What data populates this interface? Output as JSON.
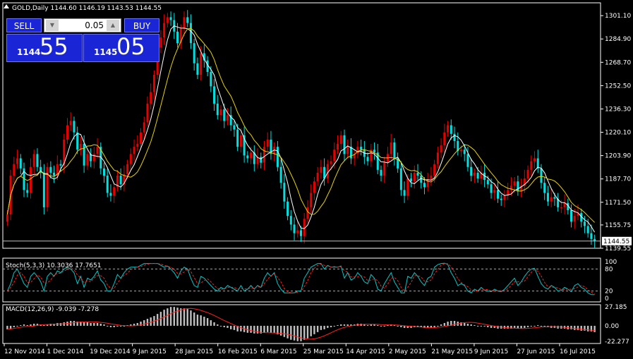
{
  "colors": {
    "background": "#000000",
    "frame": "#ffffff",
    "bull": "#e60000",
    "bear": "#00e1e1",
    "ma_fast": "#ffffff",
    "ma_slow": "#e6d200",
    "stoch_main": "#00c8c8",
    "stoch_signal": "#ff2020",
    "macd_hist": "#c0c0c0",
    "macd_signal": "#ff2020",
    "price_line": "#c0c0c0",
    "button_blue": "#1a25d6"
  },
  "header": {
    "title": "GOLD,Daily  1144.60 1146.19 1143.53 1144.55"
  },
  "trade": {
    "sell_label": "SELL",
    "buy_label": "BUY",
    "lot_value": "0.05",
    "bid_small": "1144",
    "bid_big": "55",
    "ask_small": "1145",
    "ask_big": "05",
    "down_arrow": "▼",
    "up_arrow": "▲"
  },
  "price_axis": {
    "ticks": [
      "1301.10",
      "1284.90",
      "1268.70",
      "1252.50",
      "1236.30",
      "1220.10",
      "1203.90",
      "1187.70",
      "1171.50",
      "1155.75",
      "1139.55"
    ],
    "current": "1144.55"
  },
  "stoch": {
    "label": "Stoch(5,3,3) 10.3036 17.7651",
    "ticks": [
      "100",
      "80",
      "20",
      "0"
    ]
  },
  "macd": {
    "label": "MACD(12,26,9) -9.039 -7.278",
    "ticks": [
      "27.185",
      "0.00",
      "-22.277"
    ]
  },
  "time_axis": {
    "labels": [
      "12 Nov 2014",
      "1 Dec 2014",
      "19 Dec 2014",
      "9 Jan 2015",
      "28 Jan 2015",
      "16 Feb 2015",
      "6 Mar 2015",
      "25 Mar 2015",
      "14 Apr 2015",
      "2 May 2015",
      "21 May 2015",
      "9 Jun 2015",
      "27 Jun 2015",
      "16 Jul 2015"
    ]
  },
  "chart_data": {
    "type": "candlestick",
    "title": "GOLD,Daily  1144.60 1146.19 1143.53 1144.55",
    "y_range": [
      1139.55,
      1310
    ],
    "series": [
      {
        "name": "close",
        "values": [
          1163,
          1190,
          1198,
          1202,
          1195,
          1180,
          1178,
          1196,
          1205,
          1196,
          1192,
          1168,
          1196,
          1192,
          1190,
          1198,
          1197,
          1215,
          1225,
          1228,
          1220,
          1208,
          1212,
          1197,
          1205,
          1200,
          1205,
          1210,
          1195,
          1190,
          1178,
          1176,
          1182,
          1190,
          1184,
          1191,
          1198,
          1205,
          1210,
          1212,
          1220,
          1227,
          1240,
          1248,
          1260,
          1279,
          1286,
          1296,
          1300,
          1298,
          1290,
          1282,
          1292,
          1300,
          1296,
          1282,
          1268,
          1260,
          1275,
          1270,
          1262,
          1252,
          1240,
          1232,
          1236,
          1228,
          1232,
          1225,
          1222,
          1210,
          1218,
          1204,
          1202,
          1206,
          1198,
          1203,
          1199,
          1210,
          1215,
          1205,
          1210,
          1196,
          1185,
          1172,
          1162,
          1156,
          1150,
          1152,
          1148,
          1160,
          1168,
          1178,
          1186,
          1192,
          1196,
          1188,
          1198,
          1200,
          1208,
          1212,
          1218,
          1205,
          1210,
          1202,
          1205,
          1210,
          1208,
          1203,
          1200,
          1208,
          1206,
          1194,
          1190,
          1199,
          1205,
          1213,
          1202,
          1195,
          1180,
          1176,
          1188,
          1186,
          1192,
          1190,
          1185,
          1182,
          1187,
          1190,
          1198,
          1206,
          1211,
          1220,
          1225,
          1219,
          1214,
          1207,
          1208,
          1205,
          1196,
          1190,
          1192,
          1188,
          1192,
          1187,
          1184,
          1178,
          1180,
          1174,
          1173,
          1176,
          1180,
          1183,
          1186,
          1179,
          1183,
          1188,
          1194,
          1200,
          1202,
          1195,
          1185,
          1178,
          1172,
          1175,
          1174,
          1168,
          1168,
          1171,
          1166,
          1158,
          1162,
          1164,
          1158,
          1155,
          1150,
          1146,
          1144.55
        ]
      },
      {
        "name": "stoch_main",
        "values": [
          20,
          40,
          70,
          80,
          60,
          40,
          30,
          60,
          70,
          60,
          45,
          20,
          60,
          70,
          60,
          75,
          70,
          80,
          85,
          80,
          70,
          40,
          60,
          30,
          55,
          50,
          60,
          75,
          50,
          40,
          20,
          20,
          40,
          65,
          55,
          70,
          80,
          85,
          85,
          85,
          90,
          95,
          95,
          95,
          95,
          95,
          90,
          85,
          88,
          80,
          70,
          55,
          75,
          85,
          80,
          55,
          35,
          30,
          60,
          55,
          45,
          35,
          25,
          20,
          30,
          25,
          35,
          30,
          25,
          20,
          35,
          20,
          25,
          35,
          25,
          35,
          30,
          55,
          70,
          60,
          70,
          40,
          25,
          15,
          15,
          15,
          15,
          20,
          20,
          55,
          70,
          85,
          90,
          95,
          95,
          80,
          90,
          85,
          85,
          85,
          88,
          55,
          70,
          50,
          55,
          70,
          60,
          45,
          40,
          65,
          55,
          25,
          20,
          40,
          55,
          70,
          45,
          30,
          15,
          15,
          60,
          55,
          70,
          60,
          45,
          35,
          55,
          60,
          85,
          92,
          95,
          96,
          92,
          70,
          55,
          35,
          40,
          35,
          20,
          15,
          25,
          20,
          30,
          22,
          20,
          18,
          25,
          20,
          18,
          25,
          35,
          45,
          55,
          35,
          45,
          60,
          72,
          80,
          82,
          60,
          40,
          30,
          25,
          35,
          30,
          20,
          22,
          30,
          25,
          18,
          35,
          40,
          30,
          25,
          15,
          10,
          10
        ]
      },
      {
        "name": "macd",
        "values": [
          -5,
          -4,
          -2,
          0,
          1,
          2,
          1,
          2,
          3,
          3,
          2,
          1,
          2,
          3,
          3,
          4,
          4,
          5,
          6,
          7,
          7,
          6,
          6,
          5,
          5,
          4,
          4,
          4,
          3,
          2,
          0,
          -2,
          -2,
          -1,
          -1,
          0,
          1,
          2,
          3,
          4,
          6,
          8,
          10,
          12,
          14,
          17,
          20,
          23,
          25,
          27,
          27,
          26,
          25,
          25,
          24,
          22,
          19,
          16,
          15,
          13,
          11,
          8,
          5,
          2,
          0,
          -2,
          -3,
          -5,
          -6,
          -8,
          -8,
          -9,
          -10,
          -10,
          -11,
          -11,
          -11,
          -10,
          -9,
          -10,
          -10,
          -12,
          -14,
          -16,
          -18,
          -20,
          -21,
          -22,
          -22,
          -20,
          -18,
          -15,
          -12,
          -9,
          -6,
          -5,
          -3,
          -2,
          0,
          1,
          2,
          2,
          2,
          2,
          2,
          3,
          3,
          2,
          1,
          2,
          2,
          1,
          0,
          0,
          1,
          2,
          1,
          0,
          -2,
          -3,
          -3,
          -3,
          -2,
          -2,
          -2,
          -3,
          -3,
          -3,
          -2,
          0,
          2,
          4,
          6,
          7,
          7,
          6,
          5,
          4,
          3,
          2,
          1,
          0,
          -1,
          -1,
          -2,
          -3,
          -3,
          -4,
          -4,
          -4,
          -4,
          -4,
          -3,
          -4,
          -4,
          -3,
          -2,
          -1,
          0,
          1,
          0,
          -1,
          -2,
          -3,
          -3,
          -4,
          -4,
          -4,
          -5,
          -5,
          -6,
          -6,
          -7,
          -7,
          -8,
          -8,
          -9
        ]
      }
    ]
  }
}
